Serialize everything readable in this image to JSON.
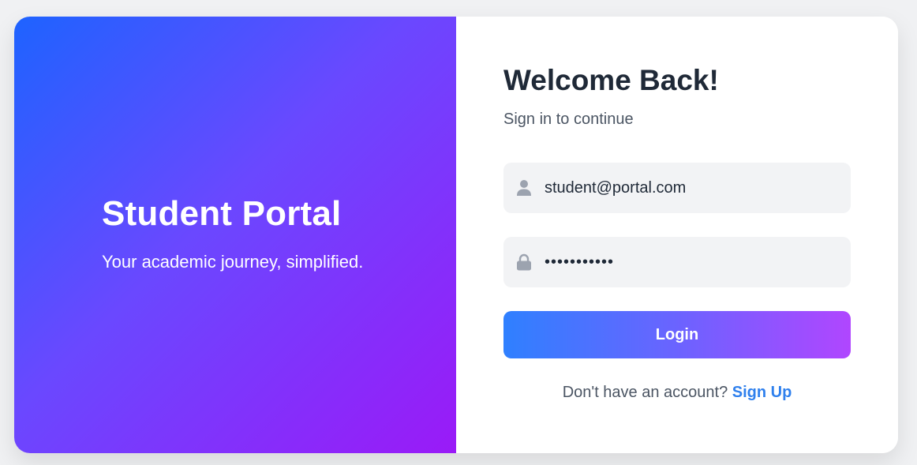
{
  "hero": {
    "title": "Student Portal",
    "subtitle": "Your academic journey, simplified."
  },
  "form": {
    "heading": "Welcome Back!",
    "subheading": "Sign in to continue",
    "email": {
      "value": "student@portal.com",
      "icon": "user-icon"
    },
    "password": {
      "value": "•••••••••••",
      "icon": "lock-icon"
    },
    "login_label": "Login",
    "signup_prompt": "Don't have an account?",
    "signup_link": "Sign Up"
  },
  "colors": {
    "page_background": "#f0f1f3",
    "hero_gradient_start": "#1e63ff",
    "hero_gradient_end": "#9a1af7",
    "button_gradient_start": "#2f80ff",
    "button_gradient_end": "#b046ff",
    "link": "#2f80ed",
    "field_background": "#f2f3f5",
    "heading": "#1f2937"
  }
}
